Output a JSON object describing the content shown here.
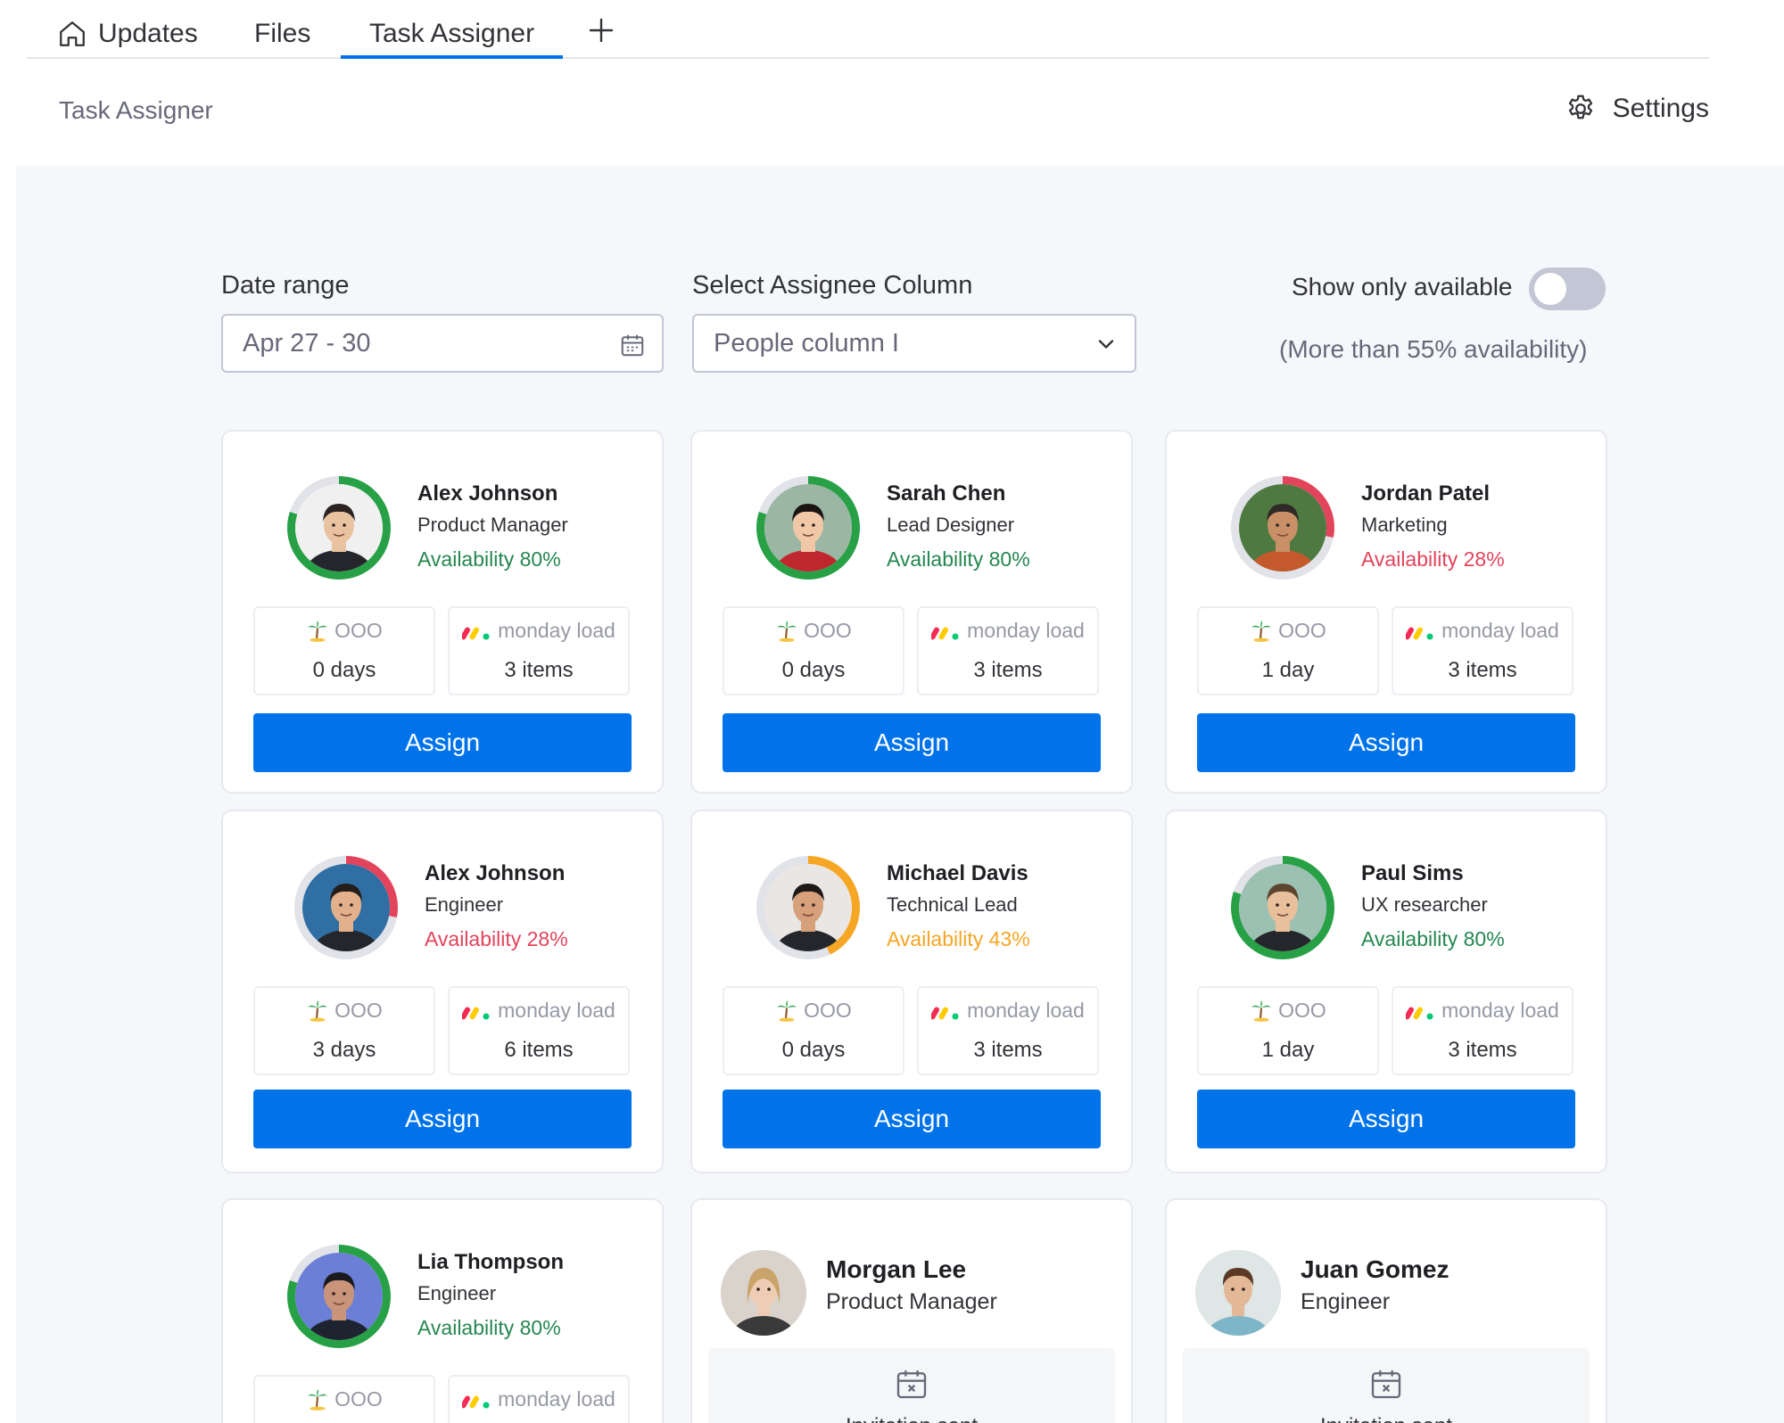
{
  "tabs": [
    {
      "label": "Updates",
      "icon": "home-icon"
    },
    {
      "label": "Files"
    },
    {
      "label": "Task Assigner",
      "active": true
    }
  ],
  "header": {
    "title": "Task Assigner",
    "settings_label": "Settings"
  },
  "filters": {
    "date_label": "Date range",
    "date_value": "Apr 27 - 30",
    "assignee_label": "Select Assignee Column",
    "assignee_value": "People column I",
    "toggle_label": "Show only available",
    "toggle_on": false,
    "toggle_hint": "(More than 55% availability)"
  },
  "labels": {
    "ooo": "OOO",
    "load": "monday load",
    "assign": "Assign",
    "invitation": "Invitation sent"
  },
  "colors": {
    "accent": "#0073ea",
    "green": "#258750",
    "ring_green": "#27a046",
    "red": "#e2445c",
    "orange": "#f5a623"
  },
  "people": [
    {
      "name": "Alex Johnson",
      "role": "Product Manager",
      "availability": "Availability 80%",
      "availability_pct": 80,
      "status": "green",
      "ooo": "0 days",
      "load": "3 items"
    },
    {
      "name": "Sarah Chen",
      "role": "Lead Designer",
      "availability": "Availability 80%",
      "availability_pct": 80,
      "status": "green",
      "ooo": "0 days",
      "load": "3 items"
    },
    {
      "name": "Jordan Patel",
      "role": "Marketing",
      "availability": "Availability 28%",
      "availability_pct": 28,
      "status": "red",
      "ooo": "1 day",
      "load": "3 items"
    },
    {
      "name": "Alex Johnson",
      "role": "Engineer",
      "availability": "Availability 28%",
      "availability_pct": 28,
      "status": "red",
      "ooo": "3 days",
      "load": "6 items"
    },
    {
      "name": "Michael Davis",
      "role": "Technical Lead",
      "availability": "Availability 43%",
      "availability_pct": 43,
      "status": "orange",
      "ooo": "0 days",
      "load": "3 items"
    },
    {
      "name": "Paul Sims",
      "role": "UX researcher",
      "availability": "Availability 80%",
      "availability_pct": 80,
      "status": "green",
      "ooo": "1 day",
      "load": "3 items"
    },
    {
      "name": "Lia Thompson",
      "role": "Engineer",
      "availability": "Availability 80%",
      "availability_pct": 80,
      "status": "green",
      "ooo": "",
      "load": ""
    }
  ],
  "invited": [
    {
      "name": "Morgan Lee",
      "role": "Product Manager"
    },
    {
      "name": "Juan Gomez",
      "role": "Engineer"
    }
  ]
}
